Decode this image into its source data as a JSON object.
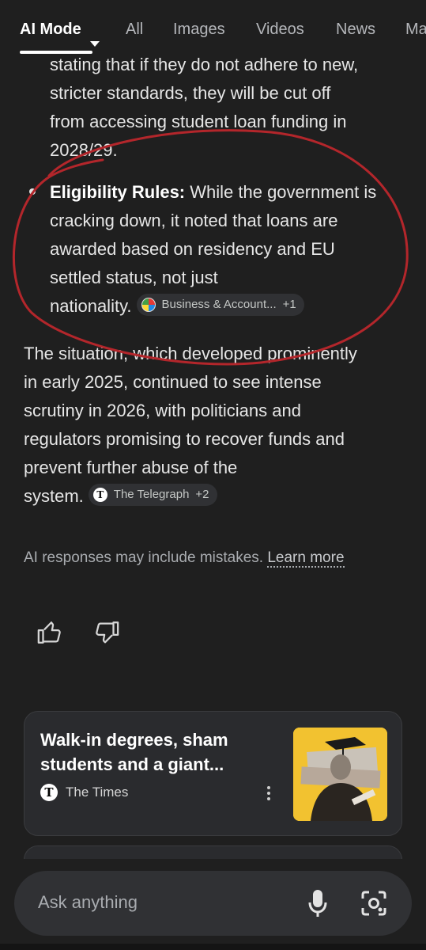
{
  "tabs": [
    {
      "label": "AI Mode",
      "active": true
    },
    {
      "label": "All"
    },
    {
      "label": "Images"
    },
    {
      "label": "Videos"
    },
    {
      "label": "News"
    },
    {
      "label": "Ma"
    }
  ],
  "answer": {
    "intro_lines": [
      "stating that if they do not adhere to new,",
      "stricter standards, they will be cut off",
      "from accessing student loan funding in",
      "2028/29."
    ],
    "bullet": {
      "bold": "Eligibility Rules:",
      "lines": [
        " While the government is",
        "cracking down, it noted that loans are",
        "awarded based on residency and EU",
        "settled status, not just",
        "nationality."
      ],
      "chip": {
        "label": "Business & Account...",
        "extra": "+1",
        "icon": "multicolor-circle-icon"
      }
    },
    "paragraph": {
      "lines": [
        "The situation, which developed prominently",
        "in early 2025, continued to see intense",
        "scrutiny in 2026, with politicians and",
        "regulators promising to recover funds and",
        "prevent further abuse of the",
        "system."
      ],
      "chip": {
        "label": "The Telegraph",
        "extra": "+2",
        "icon": "telegraph-logo-icon"
      }
    }
  },
  "disclaimer": {
    "text": "AI responses may include mistakes.",
    "link": "Learn more"
  },
  "feedback": {
    "up_icon": "thumbs-up-icon",
    "down_icon": "thumbs-down-icon"
  },
  "card": {
    "title_lines": [
      "Walk-in degrees, sham",
      "students and a giant..."
    ],
    "source_logo": "T",
    "source": "The Times"
  },
  "ask": {
    "placeholder": "Ask anything"
  },
  "colors": {
    "background": "#1f1f1f",
    "annotation": "#b3262b",
    "chip_bg": "#303134"
  }
}
